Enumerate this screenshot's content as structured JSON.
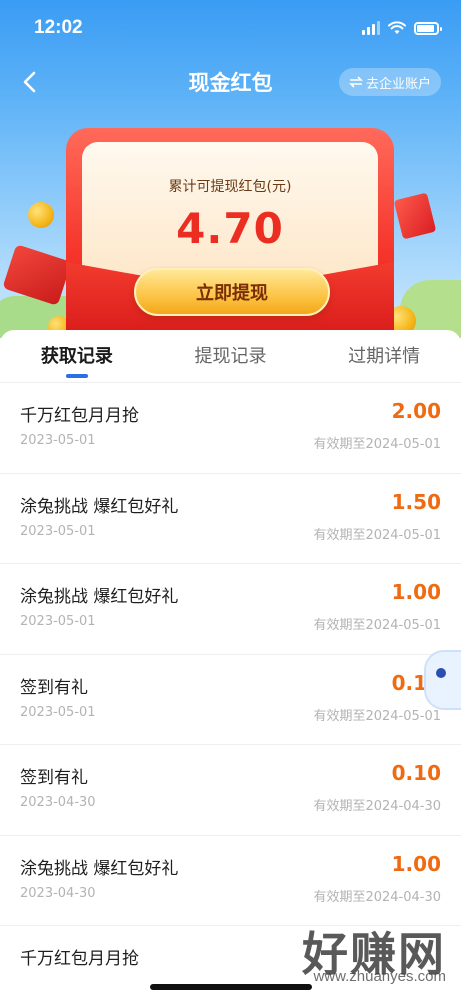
{
  "status_bar": {
    "time": "12:02"
  },
  "nav": {
    "title": "现金红包",
    "company_button": "去企业账户",
    "back_icon": "chevron-left-icon"
  },
  "envelope": {
    "label": "累计可提现红包(元)",
    "amount": "4.70",
    "withdraw_button": "立即提现"
  },
  "tabs": [
    {
      "label": "获取记录",
      "active": true
    },
    {
      "label": "提现记录",
      "active": false
    },
    {
      "label": "过期详情",
      "active": false
    }
  ],
  "records": [
    {
      "title": "千万红包月月抢",
      "date": "2023-05-01",
      "amount": "2.00",
      "expiry": "有效期至2024-05-01"
    },
    {
      "title": "涂兔挑战 爆红包好礼",
      "date": "2023-05-01",
      "amount": "1.50",
      "expiry": "有效期至2024-05-01"
    },
    {
      "title": "涂兔挑战 爆红包好礼",
      "date": "2023-05-01",
      "amount": "1.00",
      "expiry": "有效期至2024-05-01"
    },
    {
      "title": "签到有礼",
      "date": "2023-05-01",
      "amount": "0.10",
      "expiry": "有效期至2024-05-01"
    },
    {
      "title": "签到有礼",
      "date": "2023-04-30",
      "amount": "0.10",
      "expiry": "有效期至2024-04-30"
    },
    {
      "title": "涂兔挑战 爆红包好礼",
      "date": "2023-04-30",
      "amount": "1.00",
      "expiry": "有效期至2024-04-30"
    },
    {
      "title": "千万红包月月抢",
      "date": "",
      "amount": "",
      "expiry": ""
    }
  ],
  "watermark": {
    "text": "好赚网",
    "url": "www.zhuanyes.com"
  },
  "colors": {
    "accent": "#2a6fe6",
    "amount": "#ef6a10",
    "red": "#ec2d22"
  }
}
